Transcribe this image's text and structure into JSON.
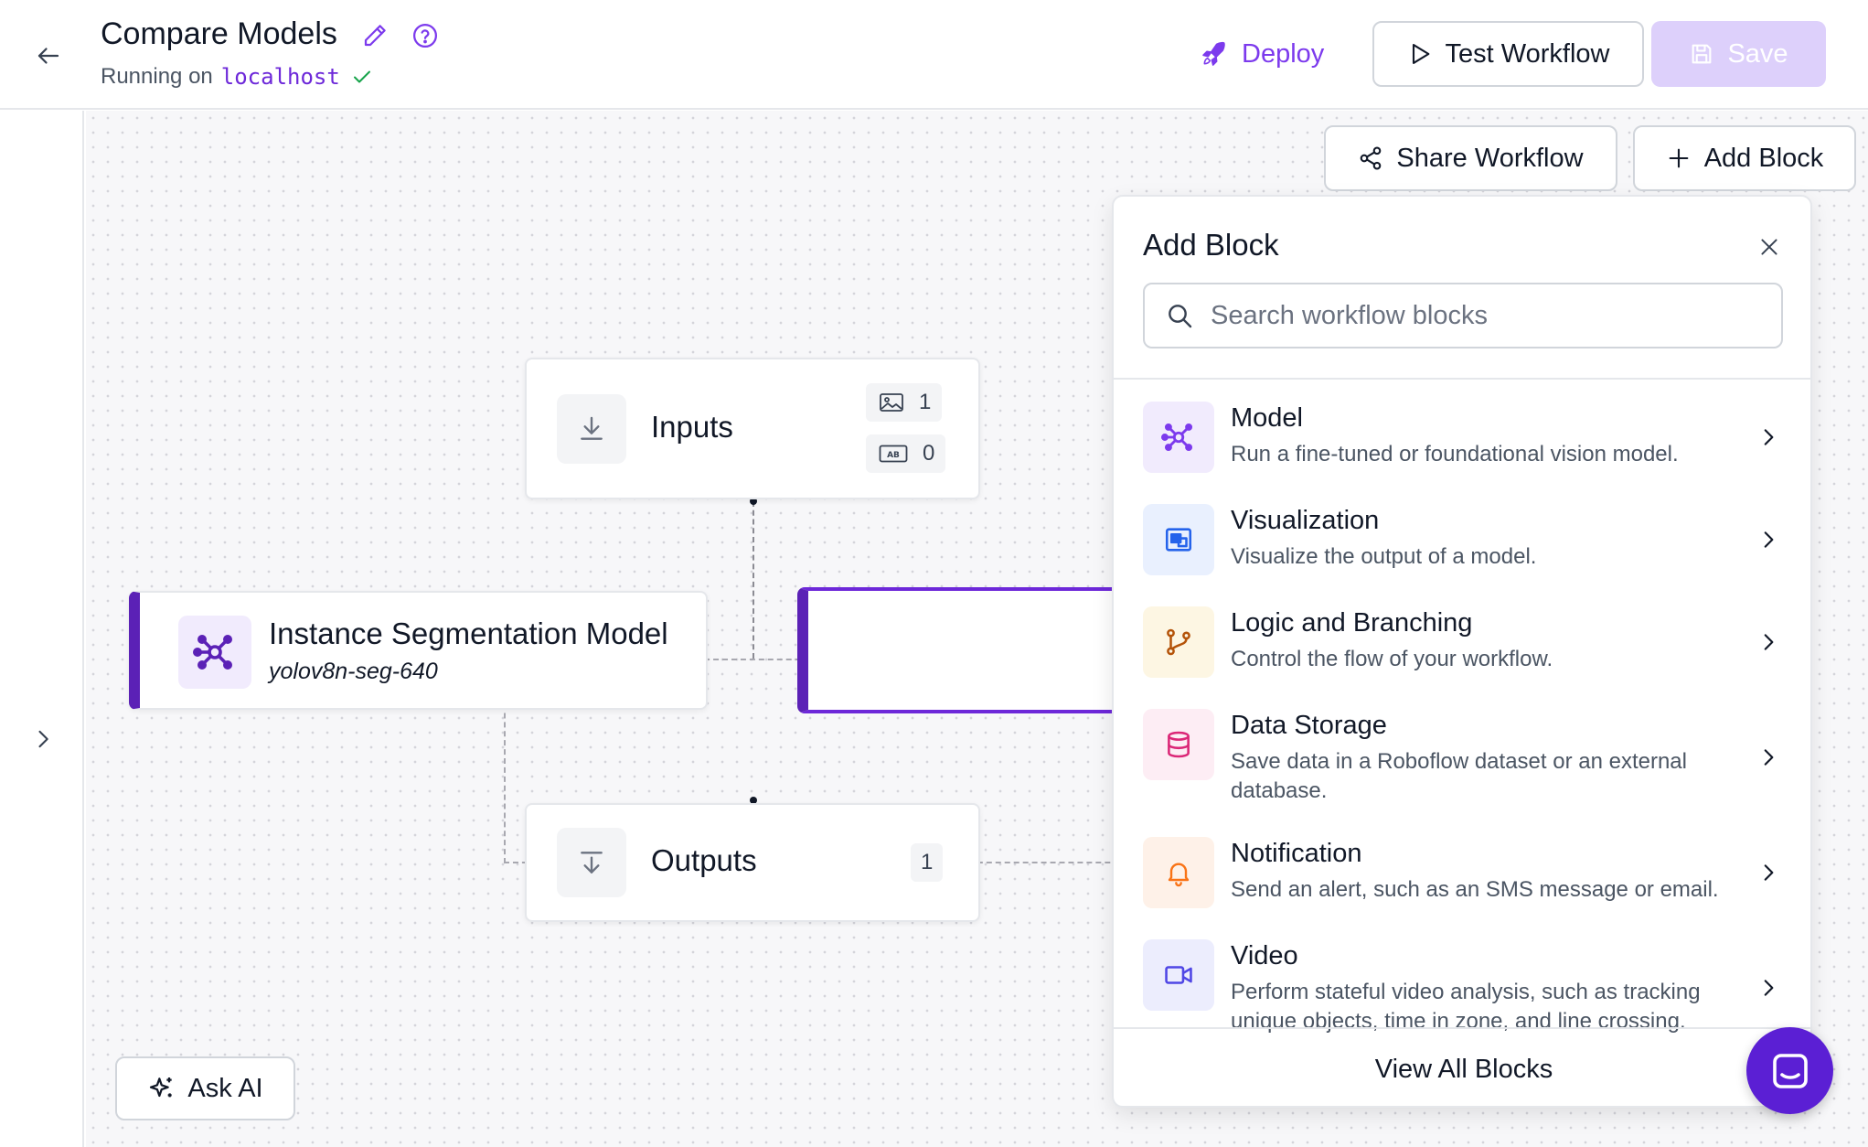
{
  "header": {
    "title": "Compare Models",
    "running_prefix": "Running on",
    "host": "localhost",
    "deploy_label": "Deploy",
    "test_label": "Test Workflow",
    "save_label": "Save"
  },
  "canvas": {
    "share_label": "Share Workflow",
    "add_block_label": "Add Block",
    "ask_ai_label": "Ask AI",
    "inputs_node": {
      "title": "Inputs",
      "image_count": "1",
      "param_count": "0"
    },
    "model_node": {
      "title": "Instance Segmentation Model",
      "model_id": "yolov8n-seg-640"
    },
    "outputs_node": {
      "title": "Outputs",
      "count": "1"
    }
  },
  "panel": {
    "title": "Add Block",
    "search_placeholder": "Search workflow blocks",
    "categories": [
      {
        "name": "Model",
        "description": "Run a fine-tuned or foundational vision model.",
        "icon": "model-icon",
        "color": "#7c3aed"
      },
      {
        "name": "Visualization",
        "description": "Visualize the output of a model.",
        "icon": "visualization-icon",
        "color": "#2563eb"
      },
      {
        "name": "Logic and Branching",
        "description": "Control the flow of your workflow.",
        "icon": "branch-icon",
        "color": "#b45309"
      },
      {
        "name": "Data Storage",
        "description": "Save data in a Roboflow dataset or an external database.",
        "icon": "database-icon",
        "color": "#db2777"
      },
      {
        "name": "Notification",
        "description": "Send an alert, such as an SMS message or email.",
        "icon": "bell-icon",
        "color": "#f97316"
      },
      {
        "name": "Video",
        "description": "Perform stateful video analysis, such as tracking unique objects, time in zone, and line crossing.",
        "icon": "video-icon",
        "color": "#4f46e5"
      }
    ],
    "view_all_label": "View All Blocks"
  },
  "colors": {
    "accent": "#7c3aed",
    "accent_dark": "#5b21b6",
    "save_disabled": "#ddd0fb"
  }
}
